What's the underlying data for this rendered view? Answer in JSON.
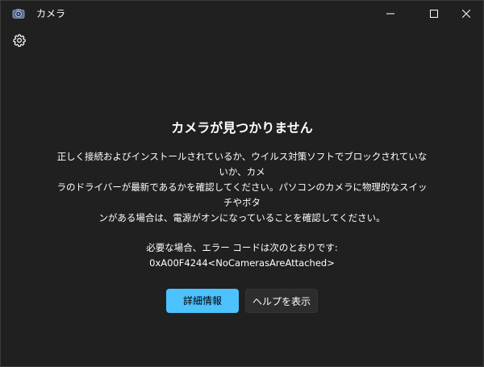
{
  "window": {
    "title": "カメラ",
    "icon": "camera-icon"
  },
  "toolbar": {
    "settings_icon": "gear-icon"
  },
  "message": {
    "heading": "カメラが見つかりません",
    "description_lines": [
      "正しく接続およびインストールされているか、ウイルス対策ソフトでブロックされていないか、カメ",
      "ラのドライバーが最新であるかを確認してください。パソコンのカメラに物理的なスイッチやボタ",
      "ンがある場合は、電源がオンになっていることを確認してください。"
    ],
    "error_intro": "必要な場合、エラー コードは次のとおりです:",
    "error_code": "0xA00F4244<NoCamerasAreAttached>"
  },
  "buttons": {
    "details_label": "詳細情報",
    "help_label": "ヘルプを表示"
  },
  "colors": {
    "background": "#202020",
    "accent": "#4cc2ff",
    "secondary_button": "#2d2d2d",
    "text": "#ffffff"
  }
}
